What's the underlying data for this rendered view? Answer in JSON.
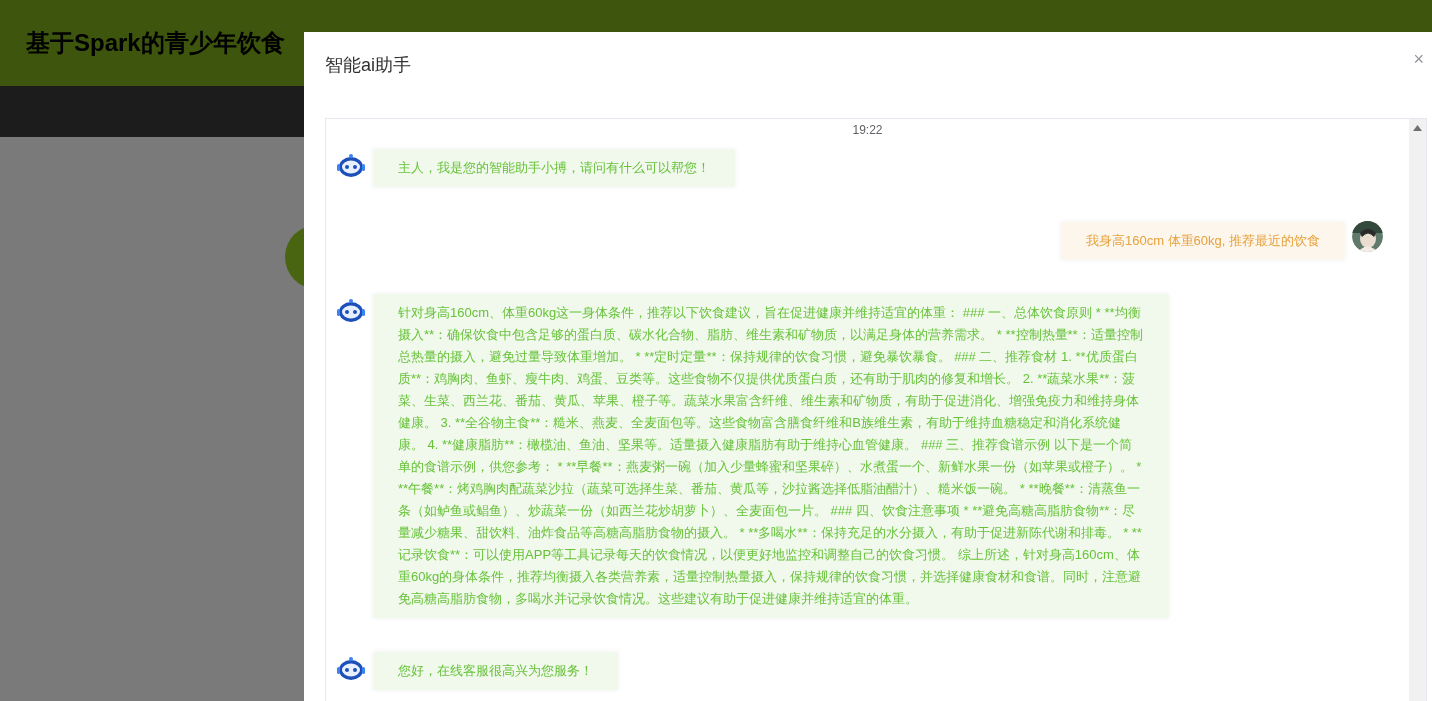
{
  "page": {
    "title": "基于Spark的青少年饮食"
  },
  "dialog": {
    "title": "智能ai助手",
    "close": "×"
  },
  "chat": {
    "time": "19:22",
    "messages": [
      {
        "kind": "bot",
        "text": "主人，我是您的智能助手小搏，请问有什么可以帮您！"
      },
      {
        "kind": "user",
        "text": "我身高160cm 体重60kg, 推荐最近的饮食"
      },
      {
        "kind": "bot",
        "text": "针对身高160cm、体重60kg这一身体条件，推荐以下饮食建议，旨在促进健康并维持适宜的体重： ### 一、总体饮食原则 * **均衡摄入**：确保饮食中包含足够的蛋白质、碳水化合物、脂肪、维生素和矿物质，以满足身体的营养需求。 * **控制热量**：适量控制总热量的摄入，避免过量导致体重增加。 * **定时定量**：保持规律的饮食习惯，避免暴饮暴食。 ### 二、推荐食材 1. **优质蛋白质**：鸡胸肉、鱼虾、瘦牛肉、鸡蛋、豆类等。这些食物不仅提供优质蛋白质，还有助于肌肉的修复和增长。 2. **蔬菜水果**：菠菜、生菜、西兰花、番茄、黄瓜、苹果、橙子等。蔬菜水果富含纤维、维生素和矿物质，有助于促进消化、增强免疫力和维持身体健康。 3. **全谷物主食**：糙米、燕麦、全麦面包等。这些食物富含膳食纤维和B族维生素，有助于维持血糖稳定和消化系统健康。 4. **健康脂肪**：橄榄油、鱼油、坚果等。适量摄入健康脂肪有助于维持心血管健康。 ### 三、推荐食谱示例 以下是一个简单的食谱示例，供您参考： * **早餐**：燕麦粥一碗（加入少量蜂蜜和坚果碎）、水煮蛋一个、新鲜水果一份（如苹果或橙子）。 * **午餐**：烤鸡胸肉配蔬菜沙拉（蔬菜可选择生菜、番茄、黄瓜等，沙拉酱选择低脂油醋汁）、糙米饭一碗。 * **晚餐**：清蒸鱼一条（如鲈鱼或鲳鱼）、炒蔬菜一份（如西兰花炒胡萝卜）、全麦面包一片。 ### 四、饮食注意事项 * **避免高糖高脂肪食物**：尽量减少糖果、甜饮料、油炸食品等高糖高脂肪食物的摄入。 * **多喝水**：保持充足的水分摄入，有助于促进新陈代谢和排毒。 * **记录饮食**：可以使用APP等工具记录每天的饮食情况，以便更好地监控和调整自己的饮食习惯。 综上所述，针对身高160cm、体重60kg的身体条件，推荐均衡摄入各类营养素，适量控制热量摄入，保持规律的饮食习惯，并选择健康食材和食谱。同时，注意避免高糖高脂肪食物，多喝水并记录饮食情况。这些建议有助于促进健康并维持适宜的体重。"
      },
      {
        "kind": "bot",
        "text": "您好，在线客服很高兴为您服务！"
      }
    ]
  }
}
